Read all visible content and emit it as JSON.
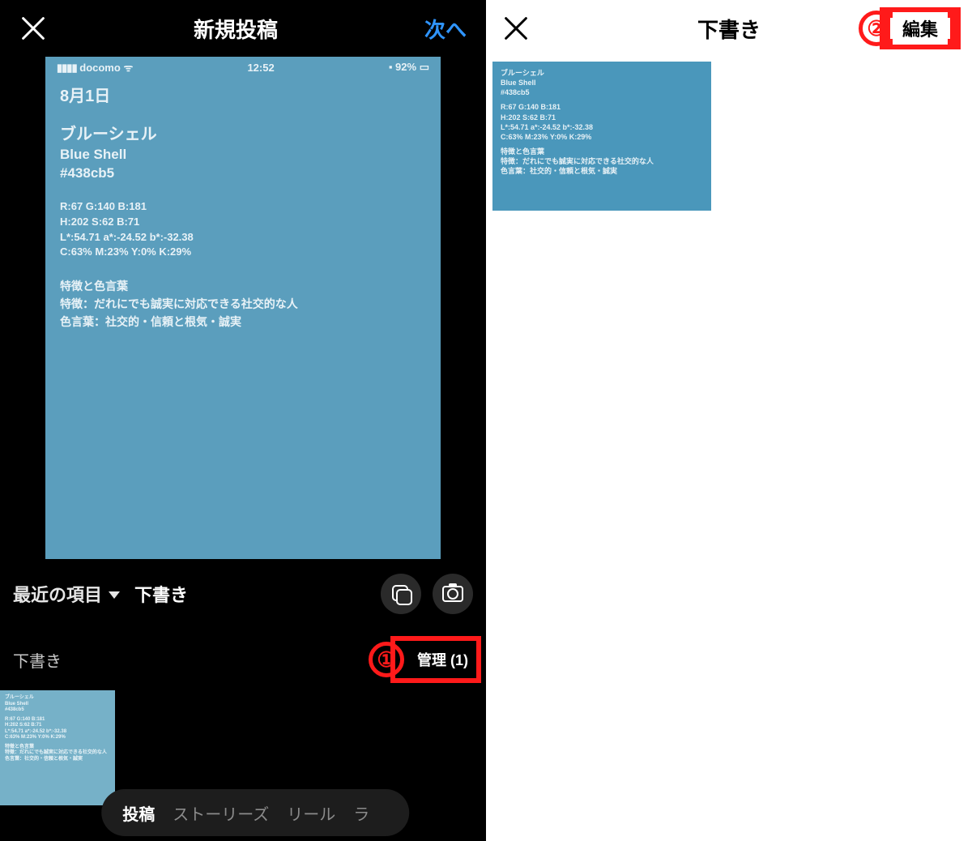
{
  "left": {
    "header": {
      "title": "新規投稿",
      "next": "次へ"
    },
    "preview": {
      "status": {
        "carrier": "docomo",
        "time": "12:52",
        "battery": "92%"
      },
      "date": "8月1日",
      "name_jp": "ブルーシェル",
      "name_en": "Blue Shell",
      "hex": "#438cb5",
      "rgb": "R:67 G:140 B:181",
      "hsb": "H:202 S:62 B:71",
      "lab": "L*:54.71 a*:-24.52 b*:-32.38",
      "cmyk": "C:63% M:23% Y:0% K:29%",
      "feat_title": "特徴と色言葉",
      "feat1": "特徴：だれにでも誠実に対応できる社交的な人",
      "feat2": "色言葉：社交的・信頼と根気・誠実"
    },
    "source": {
      "recent": "最近の項目",
      "draft": "下書き"
    },
    "drafts": {
      "label": "下書き",
      "manage": "管理 (1)"
    },
    "pill": {
      "post": "投稿",
      "stories": "ストーリーズ",
      "reel": "リール",
      "live_prefix": "ラ"
    },
    "anno1": "①"
  },
  "right": {
    "header": {
      "title": "下書き",
      "edit": "編集"
    },
    "anno2": "②",
    "thumb": {
      "l1": "ブルーシェル",
      "l2": "Blue Shell",
      "l3": "#438cb5",
      "l4": "R:67 G:140 B:181",
      "l5": "H:202 S:62 B:71",
      "l6": "L*:54.71 a*:-24.52 b*:-32.38",
      "l7": "C:63% M:23% Y:0% K:29%",
      "l8": "特徴と色言葉",
      "l9": "特徴：だれにでも誠実に対応できる社交的な人",
      "l10": "色言葉：社交的・信頼と根気・誠実"
    }
  }
}
